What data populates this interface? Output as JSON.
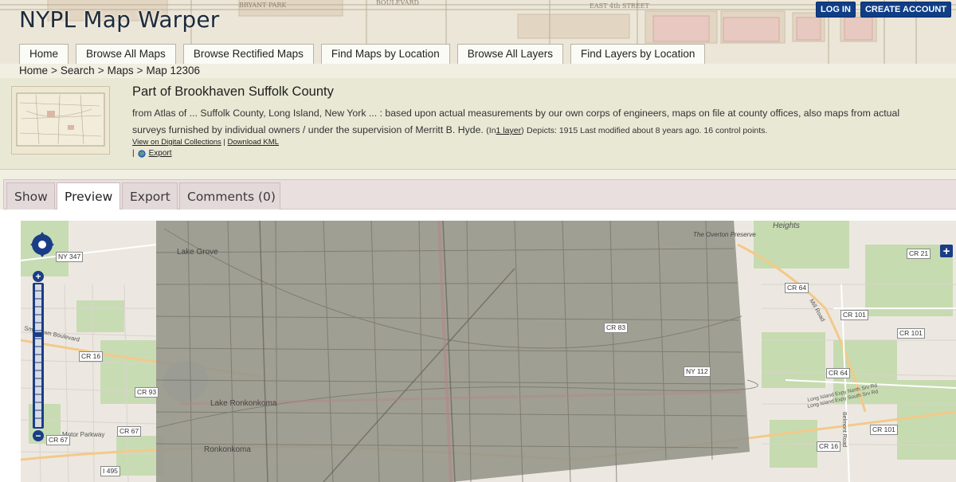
{
  "app": {
    "logo": "NYPL Map Warper",
    "login": "LOG IN",
    "create_account": "CREATE ACCOUNT"
  },
  "nav": {
    "items": [
      "Home",
      "Browse All Maps",
      "Browse Rectified Maps",
      "Find Maps by Location",
      "Browse All Layers",
      "Find Layers by Location"
    ]
  },
  "breadcrumb": {
    "items": [
      "Home",
      "Search",
      "Maps",
      "Map 12306"
    ],
    "separator": ">"
  },
  "map_info": {
    "title": "Part of Brookhaven Suffolk County",
    "description": "from Atlas of ... Suffolk County, Long Island, New York ... : based upon actual measurements by our own corps of engineers, maps on file at county offices, also maps from actual surveys furnished by individual owners / under the supervision of Merritt B. Hyde.",
    "layer_prefix": "(In",
    "layer_link": "1 layer",
    "layer_suffix": ")",
    "meta": "Depicts: 1915 Last modified about 8 years ago. 16 control points.",
    "view_link": "View on Digital Collections",
    "link_sep": "|",
    "kml_link": "Download KML",
    "export_prefix": "|",
    "export_link": "Export"
  },
  "tabs": {
    "items": [
      "Show",
      "Preview",
      "Export",
      "Comments (0)"
    ],
    "active": "Preview"
  },
  "map_view": {
    "road_labels": [
      "NY 347",
      "CR 16",
      "CR 93",
      "CR 67",
      "CR 67",
      "I 495",
      "CR 64",
      "CR 101",
      "CR 101",
      "CR 64",
      "CR 101",
      "CR 16",
      "CR 21",
      "NY 112",
      "CR 83"
    ],
    "place_labels": [
      "Lake Grove",
      "Heights",
      "Lake Ronkonkoma",
      "Ronkonkoma",
      "Motor Parkway",
      "Mill Road",
      "Long Island Expy North Srv Rd",
      "Long Island Expy South Srv Rd",
      "Smithtown Boulevard",
      "Belmont Road",
      "The Overton Preserve"
    ],
    "zoom_in": "+",
    "zoom_out": "−",
    "layer_switcher": "+"
  },
  "colors": {
    "brand_blue": "#0f3e87",
    "info_bg": "#e9e8d5",
    "tab_bg": "#e9dfdf"
  }
}
